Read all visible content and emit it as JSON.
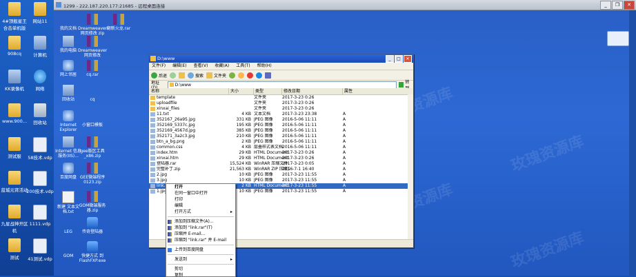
{
  "rd_title": "1299 - 222.187.220.177:21685 - 远程桌面连接",
  "host_icons": [
    {
      "label": "4#顶舰星王\n合击单机版",
      "kind": "folder"
    },
    {
      "label": "网站11",
      "kind": "folder"
    },
    {
      "label": "908cq",
      "kind": "folder"
    },
    {
      "label": "计算机",
      "kind": "comp"
    },
    {
      "label": "KK录像机",
      "kind": "comp"
    },
    {
      "label": "网络",
      "kind": "ie"
    },
    {
      "label": "www.900...",
      "kind": "folder"
    },
    {
      "label": "回收站",
      "kind": "bin"
    },
    {
      "label": "测试服",
      "kind": "folder"
    },
    {
      "label": "58技术.vdp",
      "kind": "doc"
    },
    {
      "label": "蓝城元宵活动",
      "kind": "folder"
    },
    {
      "label": "200技术.vdp",
      "kind": "doc"
    },
    {
      "label": "九星战神开区\n机",
      "kind": "folder"
    },
    {
      "label": "1111.vdp",
      "kind": "doc"
    },
    {
      "label": "测试",
      "kind": "folder"
    },
    {
      "label": "41测试.vdp",
      "kind": "doc"
    }
  ],
  "remote_icons": [
    {
      "label": "我的文档",
      "kind": "folder"
    },
    {
      "label": "Dreamweaver\n网页修改 zip",
      "kind": "rar"
    },
    {
      "label": "翻新火龙.rar",
      "kind": "rar"
    },
    {
      "label": "我的电脑",
      "kind": "comp"
    },
    {
      "label": "Dreamweaver\n网页修改",
      "kind": "rar"
    },
    {
      "label": "网上邻居",
      "kind": "net"
    },
    {
      "label": "cq.rar",
      "kind": "rar"
    },
    {
      "label": "回收站",
      "kind": "comp"
    },
    {
      "label": "cq",
      "kind": "folder"
    },
    {
      "label": "Internet\nExplorer",
      "kind": "net"
    },
    {
      "label": "小窗口模板",
      "kind": "folder"
    },
    {
      "label": "Internet 信息\n服务(IIS)...",
      "kind": "comp"
    },
    {
      "label": "gee版区工具\n_x86.zip",
      "kind": "rar"
    },
    {
      "label": "百度网盘",
      "kind": "net"
    },
    {
      "label": "GEE微端程序\n0123.zip",
      "kind": "rar"
    },
    {
      "label": "新建 文本文\n档.txt",
      "kind": "txt"
    },
    {
      "label": "GOM微端服务\n器.zip",
      "kind": "rar"
    },
    {
      "label": "LEG",
      "kind": "folder"
    },
    {
      "label": "传奇登陆器",
      "kind": "exe"
    },
    {
      "label": "GOM",
      "kind": "folder"
    },
    {
      "label": "快捷方式 到\nFlashFXP.exe",
      "kind": "exe"
    },
    {
      "label": "",
      "kind": "folder"
    }
  ],
  "explorer": {
    "title": "D:\\www",
    "menu": [
      "文件(F)",
      "编辑(E)",
      "查看(V)",
      "收藏(A)",
      "工具(T)",
      "帮助(H)"
    ],
    "toolbar": {
      "back": "后退",
      "forward": "",
      "search": "搜索",
      "folders": "文件夹"
    },
    "address_label": "地址(D)",
    "address_value": "D:\\www",
    "go_label": "转到",
    "columns": [
      "名称",
      "大小",
      "类型",
      "修改日期",
      "属性"
    ],
    "rows": [
      {
        "name": "template",
        "size": "",
        "type": "文件夹",
        "date": "2017-3-23 0:26",
        "attr": "",
        "folder": true
      },
      {
        "name": "uploadfile",
        "size": "",
        "type": "文件夹",
        "date": "2017-3-23 0:26",
        "attr": "",
        "folder": true
      },
      {
        "name": "xinxai_files",
        "size": "",
        "type": "文件夹",
        "date": "2017-3-23 0:26",
        "attr": "",
        "folder": true
      },
      {
        "name": "11.txt",
        "size": "4 KB",
        "type": "文本文档",
        "date": "2017-3-23 23:38",
        "attr": "A"
      },
      {
        "name": "352167_26a95.jpg",
        "size": "331 KB",
        "type": "JPEG 图像",
        "date": "2016-5-06 11:11",
        "attr": "A"
      },
      {
        "name": "352169_5337c.jpg",
        "size": "195 KB",
        "type": "JPEG 图像",
        "date": "2016-5-06 11:11",
        "attr": "A"
      },
      {
        "name": "352169_4567d.jpg",
        "size": "385 KB",
        "type": "JPEG 图像",
        "date": "2016-5-06 11:11",
        "attr": "A"
      },
      {
        "name": "352171_3a2c3.jpg",
        "size": "210 KB",
        "type": "JPEG 图像",
        "date": "2016-5-06 11:11",
        "attr": "A"
      },
      {
        "name": "btn_a_bg.png",
        "size": "2 KB",
        "type": "JPEG 图像",
        "date": "2016-5-06 11:11",
        "attr": "A"
      },
      {
        "name": "common.css",
        "size": "4 KB",
        "type": "层叠样式表文档",
        "date": "2016-5-06 11:11",
        "attr": "A"
      },
      {
        "name": "index.htm",
        "size": "29 KB",
        "type": "HTML Document",
        "date": "2017-3-23 0:26",
        "attr": "A"
      },
      {
        "name": "xinxai.htm",
        "size": "29 KB",
        "type": "HTML Document",
        "date": "2017-3-23 0:26",
        "attr": "A"
      },
      {
        "name": "登陆器.rar",
        "size": "15,524 KB",
        "type": "WinRAR 压缩文件",
        "date": "2017-3-23 0:05",
        "attr": "A"
      },
      {
        "name": "完整补丁.zip",
        "size": "21,563 KB",
        "type": "WinRAR ZIP 压缩文件",
        "date": "2016-7-1 16:40",
        "attr": "A"
      },
      {
        "name": "2.jpg",
        "size": "10 KB",
        "type": "JPEG 图像",
        "date": "2017-3-23 11:55",
        "attr": "A"
      },
      {
        "name": "3.jpg",
        "size": "10 KB",
        "type": "JPEG 图像",
        "date": "2017-3-23 11:55",
        "attr": "A"
      },
      {
        "name": "link.htm",
        "size": "2 KB",
        "type": "HTML Document",
        "date": "2017-3-23 11:55",
        "attr": "A",
        "selected": true
      },
      {
        "name": "1.jpg",
        "size": "10 KB",
        "type": "JPEG 图像",
        "date": "2017-3-23 11:55",
        "attr": "A"
      }
    ]
  },
  "context_menu": [
    {
      "label": "打开",
      "bold": true
    },
    {
      "label": "在同一窗口中打开"
    },
    {
      "label": "打印"
    },
    {
      "label": "编辑"
    },
    {
      "label": "打开方式",
      "sub": true
    },
    {
      "sep": true
    },
    {
      "label": "添加到压缩文件(A)...",
      "icon": "rar"
    },
    {
      "label": "添加到 \"link.rar\"(T)",
      "icon": "rar"
    },
    {
      "label": "压缩并 E-mail...",
      "icon": "rar"
    },
    {
      "label": "压缩到 \"link.rar\" 并 E-mail",
      "icon": "rar"
    },
    {
      "sep": true
    },
    {
      "label": "上传到百度网盘",
      "icon": "blue"
    },
    {
      "sep": true
    },
    {
      "label": "发送到",
      "sub": true
    },
    {
      "sep": true
    },
    {
      "label": "剪切"
    },
    {
      "label": "复制"
    }
  ],
  "watermark_text": "玫瑰资源库"
}
